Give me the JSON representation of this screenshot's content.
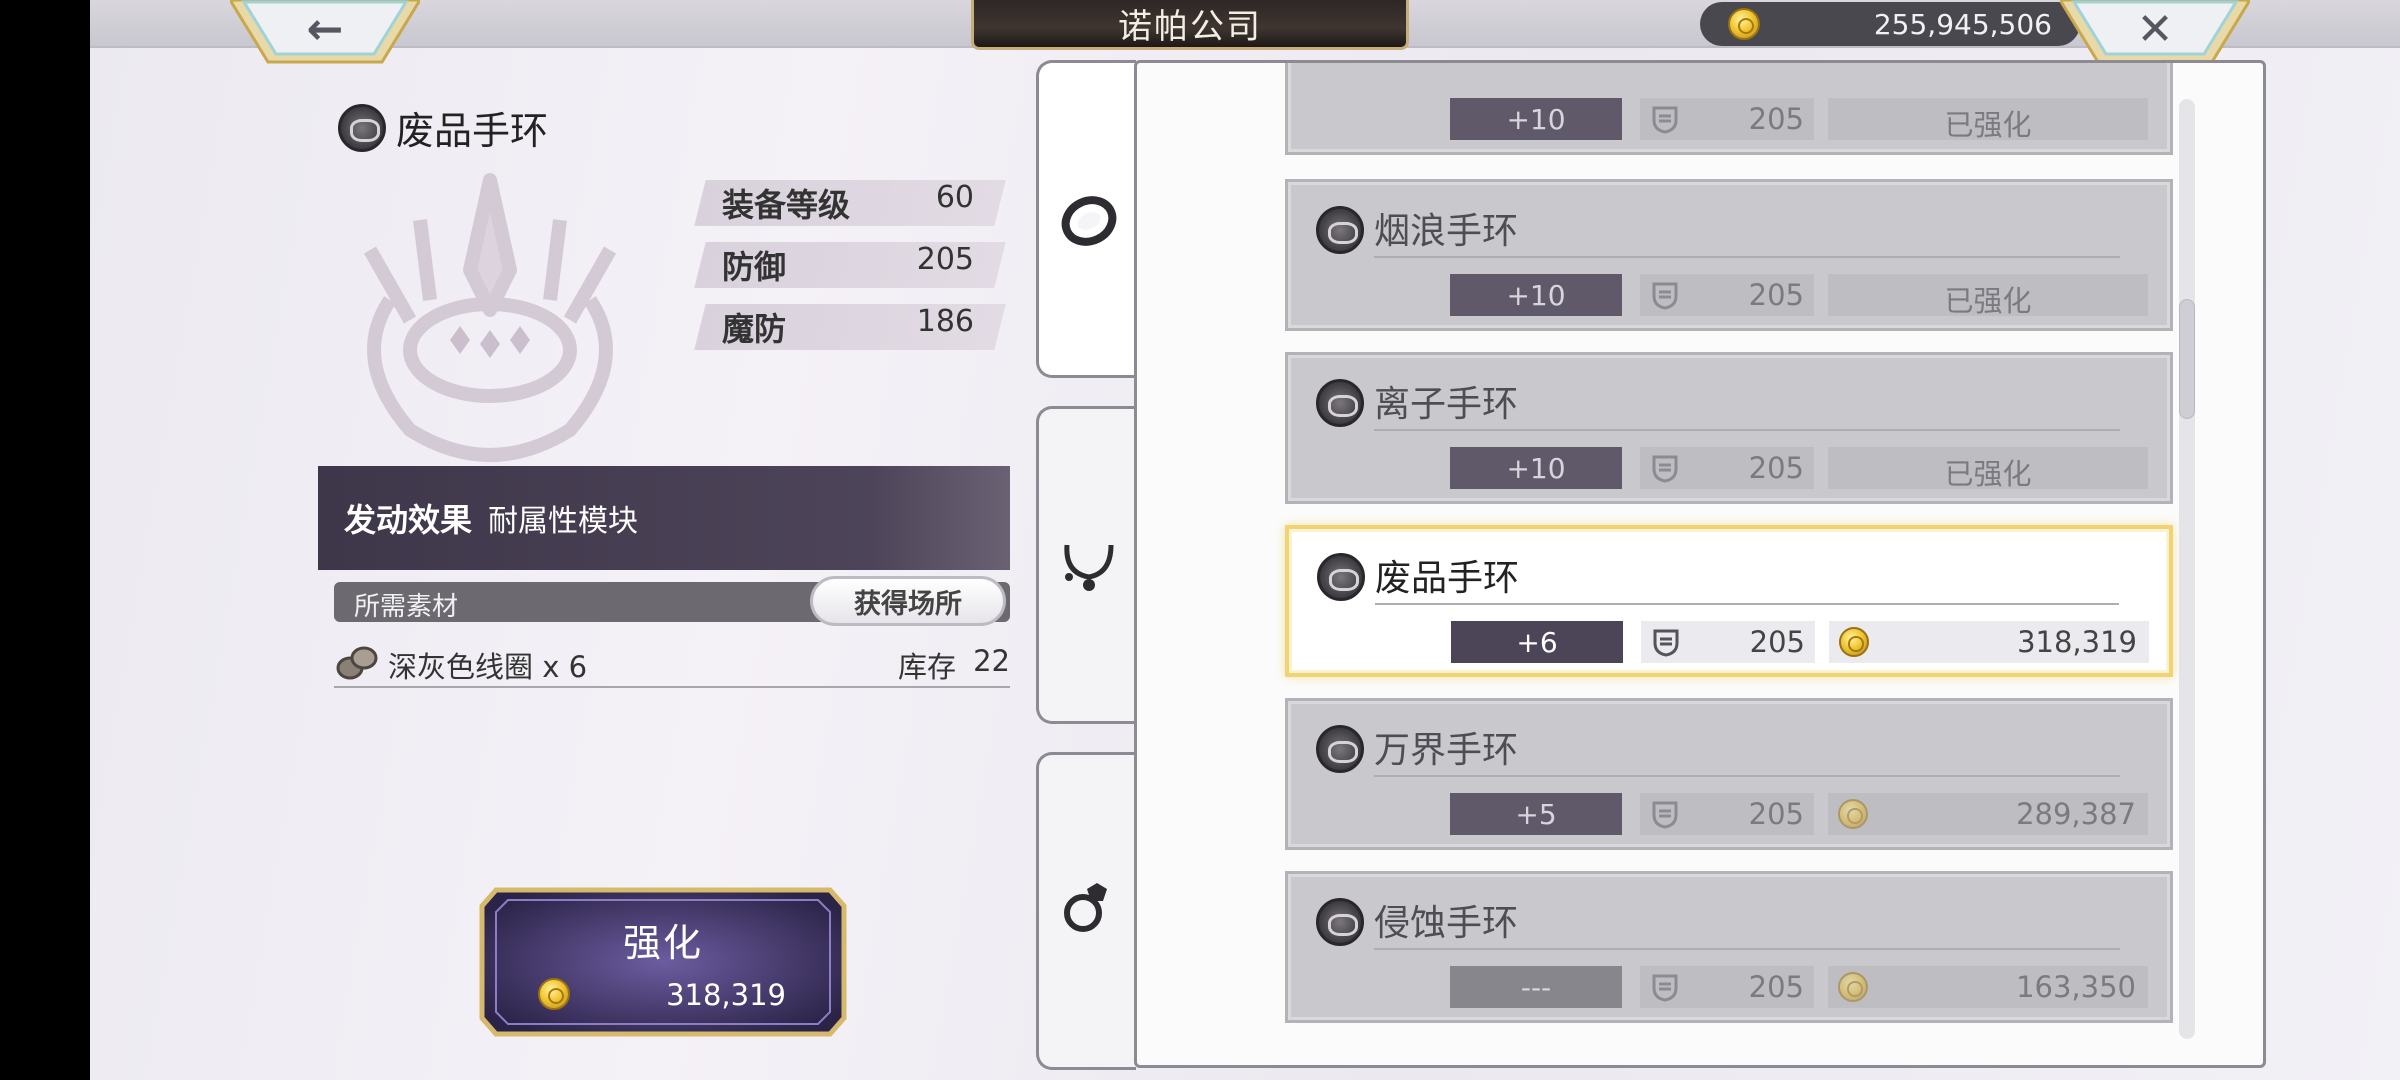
{
  "header": {
    "title": "诺帕公司",
    "back_icon": "back-arrow-icon",
    "close_icon": "close-icon",
    "currency": "255,945,506"
  },
  "detail": {
    "item_name": "废品手环",
    "stats": [
      {
        "label": "装备等级",
        "value": "60"
      },
      {
        "label": "防御",
        "value": "205"
      },
      {
        "label": "魔防",
        "value": "186"
      }
    ],
    "effect_label": "发动效果",
    "effect_value": "耐属性模块",
    "materials_label": "所需素材",
    "obtain_button": "获得场所",
    "material": {
      "name": "深灰色线圈 x 6",
      "stock_label": "库存",
      "stock": "22"
    },
    "enhance": {
      "label": "强化",
      "cost": "318,319"
    }
  },
  "tabs": [
    {
      "name": "bracelet-tab",
      "icon": "bracelet-icon",
      "active": true
    },
    {
      "name": "necklace-tab",
      "icon": "necklace-icon",
      "active": false
    },
    {
      "name": "ring-tab",
      "icon": "ring-icon",
      "active": false
    }
  ],
  "list": [
    {
      "name": "",
      "level": "+10",
      "defense": "205",
      "cost": "已强化",
      "enhanced": true
    },
    {
      "name": "烟浪手环",
      "level": "+10",
      "defense": "205",
      "cost": "已强化",
      "enhanced": true
    },
    {
      "name": "离子手环",
      "level": "+10",
      "defense": "205",
      "cost": "已强化",
      "enhanced": true
    },
    {
      "name": "废品手环",
      "level": "+6",
      "defense": "205",
      "cost": "318,319",
      "enhanced": false,
      "selected": true
    },
    {
      "name": "万界手环",
      "level": "+5",
      "defense": "205",
      "cost": "289,387",
      "enhanced": false
    },
    {
      "name": "侵蚀手环",
      "level": "---",
      "defense": "205",
      "cost": "163,350",
      "enhanced": false
    }
  ],
  "colors": {
    "accent_gold": "#f1d374",
    "panel_purple": "#3e3649",
    "coin_gold": "#f1c735"
  }
}
